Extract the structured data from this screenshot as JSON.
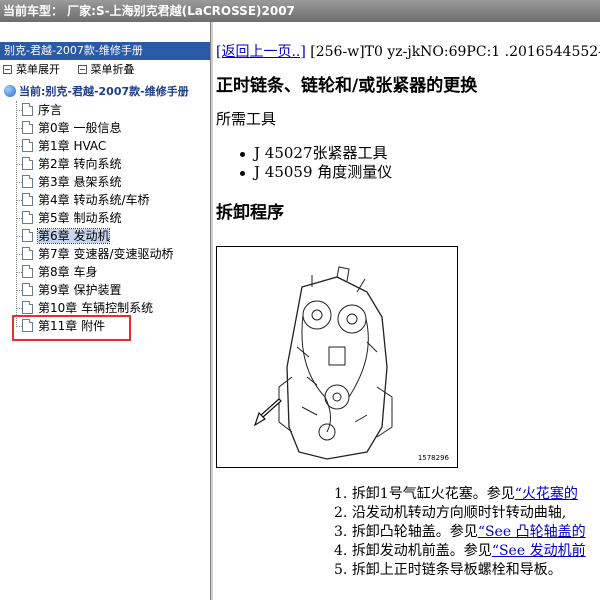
{
  "window": {
    "title": "当前车型： 厂家:S-上海别克君越(LaCROSSE)2007"
  },
  "left_pane": {
    "header": "别克-君越-2007款-维修手册",
    "toolbar": {
      "expand_label": "菜单展开",
      "collapse_label": "菜单折叠"
    },
    "tree": {
      "root_label": "当前:别克-君越-2007款-维修手册",
      "items": [
        {
          "label": "序言"
        },
        {
          "label": "第0章 一般信息"
        },
        {
          "label": "第1章 HVAC"
        },
        {
          "label": "第2章 转向系统"
        },
        {
          "label": "第3章 悬架系统"
        },
        {
          "label": "第4章 转动系统/车桥"
        },
        {
          "label": "第5章 制动系统"
        },
        {
          "label": "第6章 发动机"
        },
        {
          "label": "第7章 变速器/变速驱动桥"
        },
        {
          "label": "第8章 车身"
        },
        {
          "label": "第9章 保护装置"
        },
        {
          "label": "第10章 车辆控制系统"
        },
        {
          "label": "第11章 附件"
        }
      ],
      "selected_index": 7
    }
  },
  "content": {
    "back_link": "[返回上一页..]",
    "doc_ref": " [256-w]T0 yz-jkNO:69PC:1 .2016544552--",
    "title": "正时链条、链轮和/或张紧器的更换",
    "tools_heading": "所需工具",
    "tools": [
      "J 45027张紧器工具",
      "J 45059 角度测量仪"
    ],
    "procedure_heading": "拆卸程序",
    "figure_id": "1578296",
    "steps": [
      {
        "num": "1.",
        "text": "拆卸1号气缸火花塞。参见",
        "link": "“火花塞的"
      },
      {
        "num": "2.",
        "text": "沿发动机转动方向顺时针转动曲轴,",
        "link": ""
      },
      {
        "num": "3.",
        "text": "拆卸凸轮轴盖。参见",
        "link": "“See 凸轮轴盖的"
      },
      {
        "num": "4.",
        "text": "拆卸发动机前盖。参见",
        "link": "“See 发动机前"
      },
      {
        "num": "5.",
        "text": "拆卸上正时链条导板螺栓和导板。",
        "link": ""
      }
    ]
  },
  "colors": {
    "header_blue": "#2a5aa5",
    "link_blue": "#0000cc",
    "selection_box": "#e0312e"
  }
}
